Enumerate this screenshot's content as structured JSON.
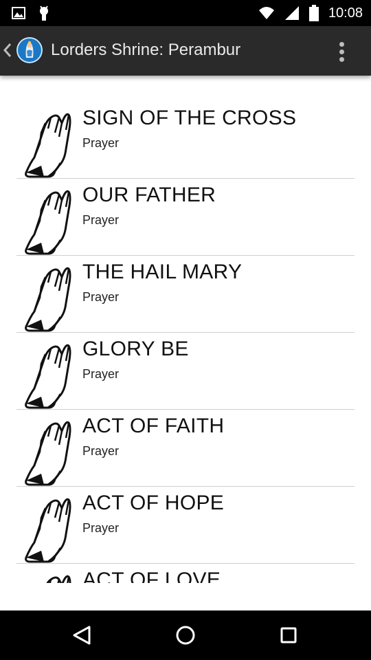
{
  "status_bar": {
    "time": "10:08",
    "left_icons": [
      "image-icon",
      "android-icon"
    ],
    "right_icons": [
      "wifi-icon",
      "signal-icon",
      "battery-icon"
    ]
  },
  "app_bar": {
    "title": "Lorders Shrine: Perambur",
    "back_icon": "chevron-left-icon",
    "overflow_icon": "more-vert-icon"
  },
  "prayers": [
    {
      "title": "SIGN OF THE CROSS",
      "subtitle": "Prayer"
    },
    {
      "title": "OUR FATHER",
      "subtitle": "Prayer"
    },
    {
      "title": "THE HAIL MARY",
      "subtitle": "Prayer"
    },
    {
      "title": "GLORY BE",
      "subtitle": "Prayer"
    },
    {
      "title": "ACT OF FAITH",
      "subtitle": "Prayer"
    },
    {
      "title": "ACT OF HOPE",
      "subtitle": "Prayer"
    },
    {
      "title": "ACT OF LOVE",
      "subtitle": ""
    }
  ],
  "nav_bar": {
    "buttons": [
      "back-triangle-icon",
      "home-circle-icon",
      "recents-square-icon"
    ]
  }
}
